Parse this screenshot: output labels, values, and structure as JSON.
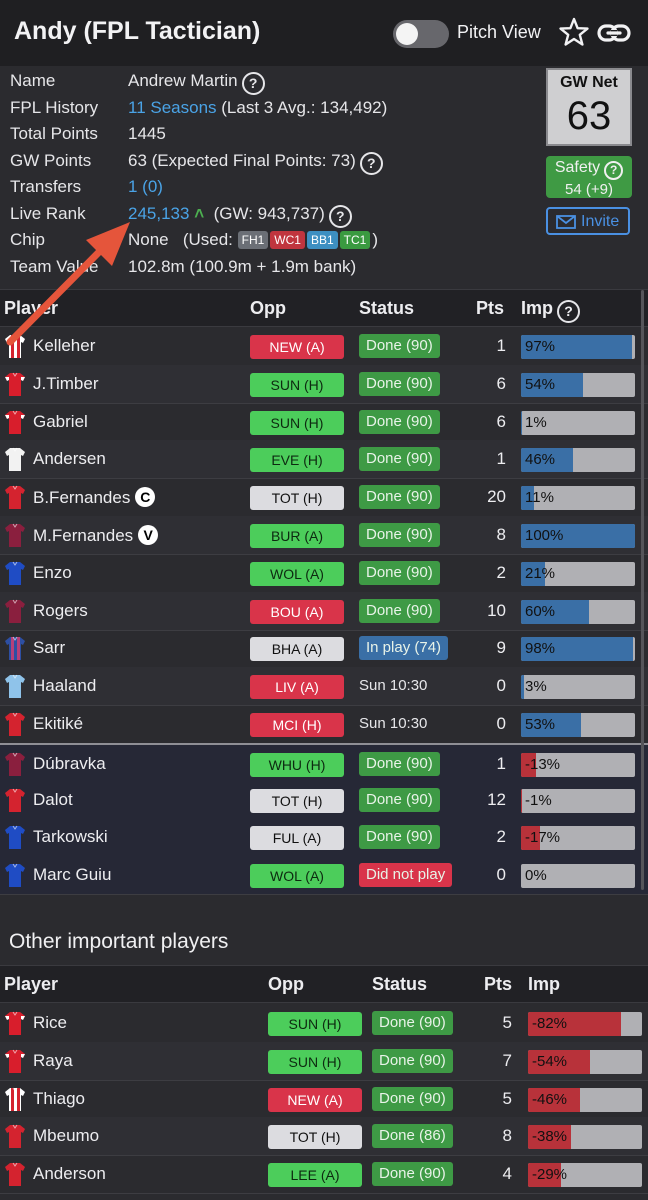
{
  "header": {
    "title": "Andy (FPL Tactician)",
    "pitch_view_label": "Pitch View",
    "pitch_view_on": false
  },
  "info": {
    "name_label": "Name",
    "name_value": "Andrew Martin",
    "history_label": "FPL History",
    "history_link": "11 Seasons",
    "history_rest": "(Last 3 Avg.: 134,492)",
    "total_label": "Total Points",
    "total_value": "1445",
    "gw_label": "GW Points",
    "gw_value": "63 (Expected Final Points: 73)",
    "transfers_label": "Transfers",
    "transfers_value": "1 (0)",
    "rank_label": "Live Rank",
    "rank_value": "245,133",
    "rank_gw": "(GW: 943,737)",
    "chip_label": "Chip",
    "chip_value": "None",
    "chip_used_prefix": "(Used:",
    "chip_used_suffix": ")",
    "chips_used": [
      {
        "name": "FH1",
        "color": "#6b6f76"
      },
      {
        "name": "WC1",
        "color": "#c0353e"
      },
      {
        "name": "BB1",
        "color": "#3d8fc1"
      },
      {
        "name": "TC1",
        "color": "#3a9a40"
      }
    ],
    "value_label": "Team Value",
    "value_value": "102.8m (100.9m + 1.9m bank)"
  },
  "side": {
    "gwnet_label": "GW Net",
    "gwnet_value": "63",
    "safety_label": "Safety",
    "safety_value": "54 (+9)",
    "invite_label": "Invite"
  },
  "table1": {
    "headers": {
      "player": "Player",
      "opp": "Opp",
      "status": "Status",
      "pts": "Pts",
      "imp": "Imp"
    },
    "rows": [
      {
        "name": "Kelleher",
        "badge": "",
        "opp": "NEW (A)",
        "opp_color": "#d9344a",
        "opp_text": "#ffffff",
        "status": "Done (90)",
        "status_color": "#3e9a45",
        "pts": "1",
        "imp_label": "97%",
        "imp": 0.97,
        "imp_color": "#3a6fa6",
        "kit": "red-white-stripes",
        "bench": false
      },
      {
        "name": "J.Timber",
        "badge": "",
        "opp": "SUN (H)",
        "opp_color": "#4ccd5b",
        "opp_text": "#0d2a10",
        "status": "Done (90)",
        "status_color": "#3e9a45",
        "pts": "6",
        "imp_label": "54%",
        "imp": 0.54,
        "imp_color": "#3a6fa6",
        "kit": "arsenal",
        "bench": false
      },
      {
        "name": "Gabriel",
        "badge": "",
        "opp": "SUN (H)",
        "opp_color": "#4ccd5b",
        "opp_text": "#0d2a10",
        "status": "Done (90)",
        "status_color": "#3e9a45",
        "pts": "6",
        "imp_label": "1%",
        "imp": 0.01,
        "imp_color": "#3a6fa6",
        "kit": "arsenal",
        "bench": false
      },
      {
        "name": "Andersen",
        "badge": "",
        "opp": "EVE (H)",
        "opp_color": "#4ccd5b",
        "opp_text": "#0d2a10",
        "status": "Done (90)",
        "status_color": "#3e9a45",
        "pts": "1",
        "imp_label": "46%",
        "imp": 0.46,
        "imp_color": "#3a6fa6",
        "kit": "white",
        "bench": false
      },
      {
        "name": "B.Fernandes",
        "badge": "C",
        "opp": "TOT (H)",
        "opp_color": "#dcdce0",
        "opp_text": "#111111",
        "status": "Done (90)",
        "status_color": "#3e9a45",
        "pts": "20",
        "imp_label": "11%",
        "imp": 0.11,
        "imp_color": "#3a6fa6",
        "kit": "red",
        "bench": false
      },
      {
        "name": "M.Fernandes",
        "badge": "V",
        "opp": "BUR (A)",
        "opp_color": "#4ccd5b",
        "opp_text": "#0d2a10",
        "status": "Done (90)",
        "status_color": "#3e9a45",
        "pts": "8",
        "imp_label": "100%",
        "imp": 1.0,
        "imp_color": "#3a6fa6",
        "kit": "claret",
        "bench": false
      },
      {
        "name": "Enzo",
        "badge": "",
        "opp": "WOL (A)",
        "opp_color": "#4ccd5b",
        "opp_text": "#0d2a10",
        "status": "Done (90)",
        "status_color": "#3e9a45",
        "pts": "2",
        "imp_label": "21%",
        "imp": 0.21,
        "imp_color": "#3a6fa6",
        "kit": "blue",
        "bench": false
      },
      {
        "name": "Rogers",
        "badge": "",
        "opp": "BOU (A)",
        "opp_color": "#d9344a",
        "opp_text": "#ffffff",
        "status": "Done (90)",
        "status_color": "#3e9a45",
        "pts": "10",
        "imp_label": "60%",
        "imp": 0.6,
        "imp_color": "#3a6fa6",
        "kit": "claret",
        "bench": false
      },
      {
        "name": "Sarr",
        "badge": "",
        "opp": "BHA (A)",
        "opp_color": "#dcdce0",
        "opp_text": "#111111",
        "status": "In play (74)",
        "status_color": "#3a6fa6",
        "pts": "9",
        "imp_label": "98%",
        "imp": 0.98,
        "imp_color": "#3a6fa6",
        "kit": "palace",
        "bench": false
      },
      {
        "name": "Haaland",
        "badge": "",
        "opp": "LIV (A)",
        "opp_color": "#d9344a",
        "opp_text": "#ffffff",
        "status": "Sun 10:30",
        "status_color": "",
        "pts": "0",
        "imp_label": "3%",
        "imp": 0.03,
        "imp_color": "#3a6fa6",
        "kit": "skyblue",
        "bench": false
      },
      {
        "name": "Ekitiké",
        "badge": "",
        "opp": "MCI (H)",
        "opp_color": "#d9344a",
        "opp_text": "#ffffff",
        "status": "Sun 10:30",
        "status_color": "",
        "pts": "0",
        "imp_label": "53%",
        "imp": 0.53,
        "imp_color": "#3a6fa6",
        "kit": "red",
        "bench": false
      },
      {
        "name": "Dúbravka",
        "badge": "",
        "opp": "WHU (H)",
        "opp_color": "#4ccd5b",
        "opp_text": "#0d2a10",
        "status": "Done (90)",
        "status_color": "#3e9a45",
        "pts": "1",
        "imp_label": "-13%",
        "imp": 0.13,
        "imp_color": "#b8323a",
        "kit": "claret",
        "bench": true
      },
      {
        "name": "Dalot",
        "badge": "",
        "opp": "TOT (H)",
        "opp_color": "#dcdce0",
        "opp_text": "#111111",
        "status": "Done (90)",
        "status_color": "#3e9a45",
        "pts": "12",
        "imp_label": "-1%",
        "imp": 0.01,
        "imp_color": "#b8323a",
        "kit": "red",
        "bench": true
      },
      {
        "name": "Tarkowski",
        "badge": "",
        "opp": "FUL (A)",
        "opp_color": "#dcdce0",
        "opp_text": "#111111",
        "status": "Done (90)",
        "status_color": "#3e9a45",
        "pts": "2",
        "imp_label": "-17%",
        "imp": 0.17,
        "imp_color": "#b8323a",
        "kit": "blue",
        "bench": true
      },
      {
        "name": "Marc Guiu",
        "badge": "",
        "opp": "WOL (A)",
        "opp_color": "#4ccd5b",
        "opp_text": "#0d2a10",
        "status": "Did not play",
        "status_color": "#d9344a",
        "pts": "0",
        "imp_label": "0%",
        "imp": 0.0,
        "imp_color": "#b8323a",
        "kit": "blue",
        "bench": true
      }
    ]
  },
  "other": {
    "title": "Other important players",
    "headers": {
      "player": "Player",
      "opp": "Opp",
      "status": "Status",
      "pts": "Pts",
      "imp": "Imp"
    },
    "rows": [
      {
        "name": "Rice",
        "opp": "SUN (H)",
        "opp_color": "#4ccd5b",
        "opp_text": "#0d2a10",
        "status": "Done (90)",
        "status_color": "#3e9a45",
        "pts": "5",
        "imp_label": "-82%",
        "imp": 0.82,
        "imp_color": "#b8323a",
        "kit": "arsenal"
      },
      {
        "name": "Raya",
        "opp": "SUN (H)",
        "opp_color": "#4ccd5b",
        "opp_text": "#0d2a10",
        "status": "Done (90)",
        "status_color": "#3e9a45",
        "pts": "7",
        "imp_label": "-54%",
        "imp": 0.54,
        "imp_color": "#b8323a",
        "kit": "arsenal"
      },
      {
        "name": "Thiago",
        "opp": "NEW (A)",
        "opp_color": "#d9344a",
        "opp_text": "#ffffff",
        "status": "Done (90)",
        "status_color": "#3e9a45",
        "pts": "5",
        "imp_label": "-46%",
        "imp": 0.46,
        "imp_color": "#b8323a",
        "kit": "red-white-stripes"
      },
      {
        "name": "Mbeumo",
        "opp": "TOT (H)",
        "opp_color": "#dcdce0",
        "opp_text": "#111111",
        "status": "Done (86)",
        "status_color": "#3e9a45",
        "pts": "8",
        "imp_label": "-38%",
        "imp": 0.38,
        "imp_color": "#b8323a",
        "kit": "red"
      },
      {
        "name": "Anderson",
        "opp": "LEE (A)",
        "opp_color": "#4ccd5b",
        "opp_text": "#0d2a10",
        "status": "Done (90)",
        "status_color": "#3e9a45",
        "pts": "4",
        "imp_label": "-29%",
        "imp": 0.29,
        "imp_color": "#b8323a",
        "kit": "red"
      }
    ]
  },
  "colors": {
    "arrow": "#e5553b",
    "kits": {
      "arsenal": [
        "#d81e2c",
        "#ffffff"
      ],
      "red": [
        "#d4232f",
        "#d4232f"
      ],
      "white": [
        "#f2f2f2",
        "#f2f2f2"
      ],
      "claret": [
        "#8a1f3e",
        "#8a1f3e"
      ],
      "blue": [
        "#1f4cc4",
        "#1f4cc4"
      ],
      "palace": [
        "#b5407a",
        "#2d4fa3"
      ],
      "skyblue": [
        "#8fc3ea",
        "#8fc3ea"
      ],
      "red-white-stripes": [
        "#d4232f",
        "#ffffff"
      ]
    }
  }
}
